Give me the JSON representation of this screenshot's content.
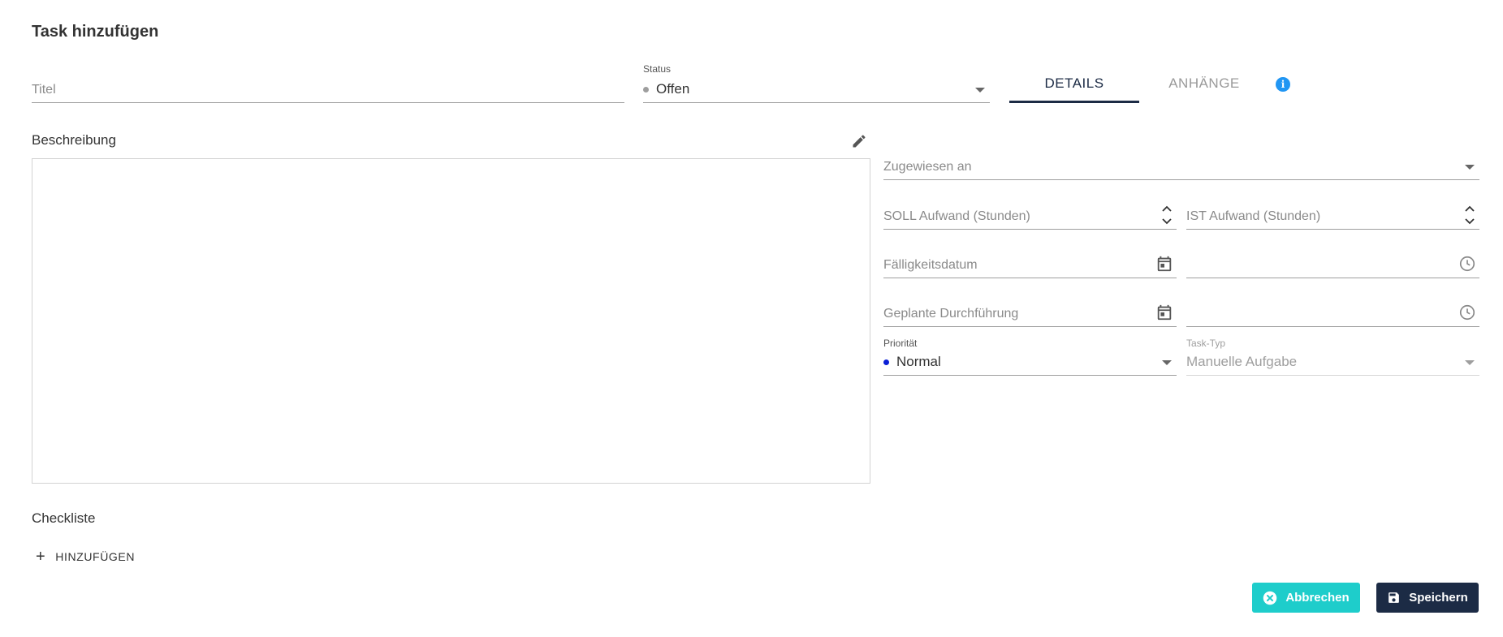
{
  "title": "Task hinzufügen",
  "form": {
    "titel_placeholder": "Titel",
    "status_label": "Status",
    "status_value": "Offen",
    "status_color": "#9e9e9e",
    "beschreibung_label": "Beschreibung",
    "zugewiesen_placeholder": "Zugewiesen an",
    "soll_placeholder": "SOLL Aufwand (Stunden)",
    "ist_placeholder": "IST Aufwand (Stunden)",
    "faelligkeit_placeholder": "Fälligkeitsdatum",
    "geplant_placeholder": "Geplante Durchführung",
    "prioritaet_label": "Priorität",
    "prioritaet_value": "Normal",
    "prioritaet_color": "#0b1fd6",
    "tasktyp_label": "Task-Typ",
    "tasktyp_value": "Manuelle Aufgabe"
  },
  "tabs": [
    {
      "label": "DETAILS",
      "active": true
    },
    {
      "label": "ANHÄNGE",
      "active": false
    }
  ],
  "checklist": {
    "label": "Checkliste",
    "add_label": "HINZUFÜGEN"
  },
  "actions": {
    "cancel_label": "Abbrechen",
    "save_label": "Speichern"
  },
  "colors": {
    "primary": "#1c2b45",
    "accent": "#1ecdcb",
    "info": "#2196f3"
  },
  "icons": [
    "info-icon",
    "pencil-icon",
    "calendar-icon",
    "clock-icon",
    "plus-icon",
    "close-circle-icon",
    "save-icon",
    "chevron-down-icon",
    "stepper-icon"
  ]
}
